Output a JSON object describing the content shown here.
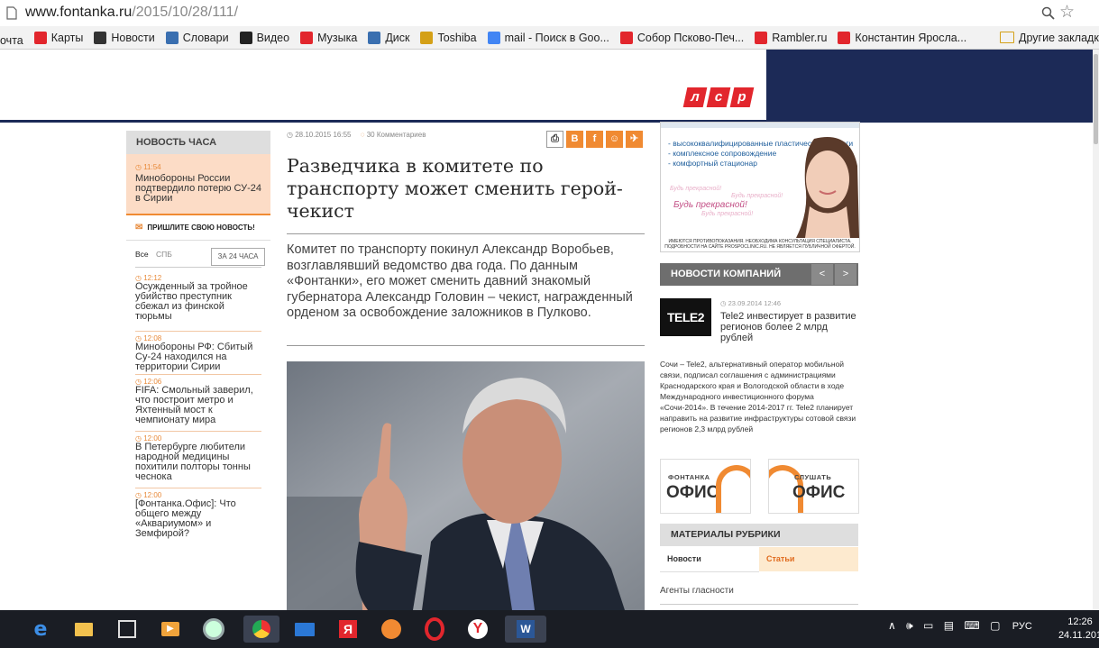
{
  "browser": {
    "url_host": "www.fontanka.ru",
    "url_path": "/2015/10/28/111/",
    "bookmarks": [
      {
        "label": "очта",
        "icon": "mail-icon",
        "color": "#555555"
      },
      {
        "label": "Карты",
        "icon": "map-pin-icon",
        "color": "#e2262d"
      },
      {
        "label": "Новости",
        "icon": "news-icon",
        "color": "#333333"
      },
      {
        "label": "Словари",
        "icon": "dictionary-icon",
        "color": "#3a6fb0"
      },
      {
        "label": "Видео",
        "icon": "play-icon",
        "color": "#222222"
      },
      {
        "label": "Музыка",
        "icon": "music-icon",
        "color": "#e2262d"
      },
      {
        "label": "Диск",
        "icon": "disk-icon",
        "color": "#3a6fb0"
      },
      {
        "label": "Toshiba",
        "icon": "folder-icon",
        "color": "#d4a017"
      },
      {
        "label": "mail - Поиск в Goo...",
        "icon": "google-icon",
        "color": "#4285f4"
      },
      {
        "label": "Собор Псково-Печ...",
        "icon": "yandex-icon",
        "color": "#e2262d"
      },
      {
        "label": "Rambler.ru",
        "icon": "yandex-icon",
        "color": "#e2262d"
      },
      {
        "label": "Константин Яросла...",
        "icon": "yandex-icon",
        "color": "#e2262d"
      }
    ],
    "other_bookmarks": "Другие закладки"
  },
  "header": {
    "logo_letters": [
      "л",
      "с",
      "р"
    ]
  },
  "left": {
    "hour_title": "НОВОСТЬ ЧАСА",
    "hour_news": {
      "time": "11:54",
      "text": "Минобороны России подтвердило потерю СУ-24 в Сирии"
    },
    "send_news": "ПРИШЛИТЕ СВОЮ НОВОСТЬ!",
    "tabs": {
      "all": "Все",
      "spb": "СПБ",
      "day": "ЗА 24 ЧАСА"
    },
    "items": [
      {
        "time": "12:12",
        "text": "Осужденный за тройное убийство преступник сбежал из финской тюрьмы"
      },
      {
        "time": "12:08",
        "text": "Минобороны РФ: Сбитый Су-24 находился на территории Сирии"
      },
      {
        "time": "12:06",
        "text": "FIFA: Смольный заверил, что построит метро и Яхтенный мост к чемпионату мира"
      },
      {
        "time": "12:00",
        "text": "В Петербурге любители народной медицины похитили полторы тонны чеснока"
      },
      {
        "time": "12:00",
        "text": "[Фонтанка.Офис]: Что общего между «Аквариумом» и Земфирой?"
      }
    ]
  },
  "article": {
    "date": "28.10.2015 16:55",
    "comments": "30 Комментариев",
    "title": "Разведчика в комитете по транспорту может сменить герой-чекист",
    "lead": "Комитет по транспорту покинул Александр Воробьев, возглавлявший ведомство два года. По данным «Фонтанки», его может сменить давний знакомый губернатора Александр Головин – чекист, награжденный орденом за освобождение заложников в Пулково."
  },
  "right": {
    "ad": {
      "bullets": [
        "высококвалифицированные пластические хирурги",
        "комплексное сопровождение",
        "комфортный стационар"
      ],
      "slogan": "Будь прекрасной!",
      "disclaimer": "ИМЕЮТСЯ ПРОТИВОПОКАЗАНИЯ. НЕОБХОДИМА КОНСУЛЬТАЦИЯ СПЕЦИАЛИСТА. ПОДРОБНОСТИ НА САЙТЕ PROSPOCLINIC.RU. НЕ ЯВЛЯЕТСЯ ПУБЛИЧНОЙ ОФЕРТОЙ."
    },
    "company_news": {
      "title": "НОВОСТИ КОМПАНИЙ",
      "prev": "<",
      "next": ">",
      "logo": "TELE2",
      "date": "23.09.2014 12:46",
      "headline": "Tele2 инвестирует в развитие регионов более 2 млрд рублей",
      "body": "Сочи – Tele2, альтернативный оператор мобильной связи, подписал соглашения с администрациями Краснодарского края и Вологодской области в ходе Международного инвестиционного форума «Сочи-2014». В течение 2014-2017 гг. Tele2 планирует направить на развитие инфраструктуры сотовой связи регионов 2,3 млрд рублей"
    },
    "office_banners": [
      {
        "top": "ФОНТАНКА",
        "bottom": "ОФИС"
      },
      {
        "top": "СЛУШАТЬ",
        "bottom": "ОФИС"
      }
    ],
    "rubric": {
      "title": "МАТЕРИАЛЫ РУБРИКИ",
      "tab_news": "Новости",
      "tab_articles": "Статьи",
      "agents": "Агенты гласности"
    }
  },
  "taskbar": {
    "lang": "РУС",
    "time": "12:26",
    "date": "24.11.201"
  }
}
